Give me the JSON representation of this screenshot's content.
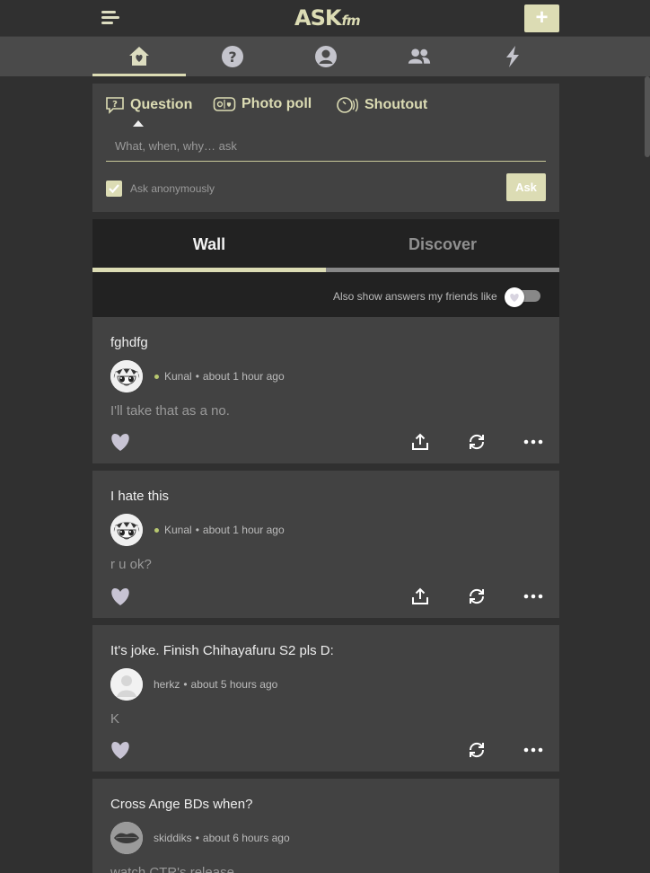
{
  "brand": {
    "logo_main": "ASK",
    "logo_sub": "fm",
    "accent": "#dcdcb4"
  },
  "topbar": {
    "menu_icon": "hamburger-icon",
    "add_label": "+"
  },
  "nav": {
    "items": [
      {
        "name": "home",
        "icon": "home-heart-icon",
        "active": true
      },
      {
        "name": "questions",
        "icon": "question-icon",
        "active": false
      },
      {
        "name": "profile",
        "icon": "user-icon",
        "active": false
      },
      {
        "name": "friends",
        "icon": "friends-icon",
        "active": false
      },
      {
        "name": "activity",
        "icon": "lightning-icon",
        "active": false
      }
    ]
  },
  "composer": {
    "tabs": [
      {
        "label": "Question",
        "icon": "question-bubble-icon"
      },
      {
        "label": "Photo poll",
        "icon": "photo-poll-icon"
      },
      {
        "label": "Shoutout",
        "icon": "shoutout-icon"
      }
    ],
    "placeholder": "What, when, why… ask",
    "anonymous_label": "Ask anonymously",
    "anonymous_checked": true,
    "ask_label": "Ask"
  },
  "feed": {
    "tabs": {
      "wall": "Wall",
      "discover": "Discover",
      "active": "wall"
    },
    "friends_toggle_label": "Also show answers my friends like",
    "friends_toggle_on": false
  },
  "posts": [
    {
      "question": "fghdfg",
      "user": "Kunal",
      "online": true,
      "time": "about 1 hour ago",
      "answer": "I'll take that as a no.",
      "avatar": "anime-avatar"
    },
    {
      "question": "I hate this",
      "user": "Kunal",
      "online": true,
      "time": "about 1 hour ago",
      "answer": "r u ok?",
      "avatar": "anime-avatar"
    },
    {
      "question": "It's joke. Finish Chihayafuru S2 pls D:",
      "user": "herkz",
      "online": false,
      "time": "about 5 hours ago",
      "answer": "K",
      "avatar": "default-avatar"
    },
    {
      "question": "Cross Ange BDs when?",
      "user": "skiddiks",
      "online": false,
      "time": "about 6 hours ago",
      "answer": "watch CTR's release",
      "avatar": "lips-avatar"
    }
  ]
}
